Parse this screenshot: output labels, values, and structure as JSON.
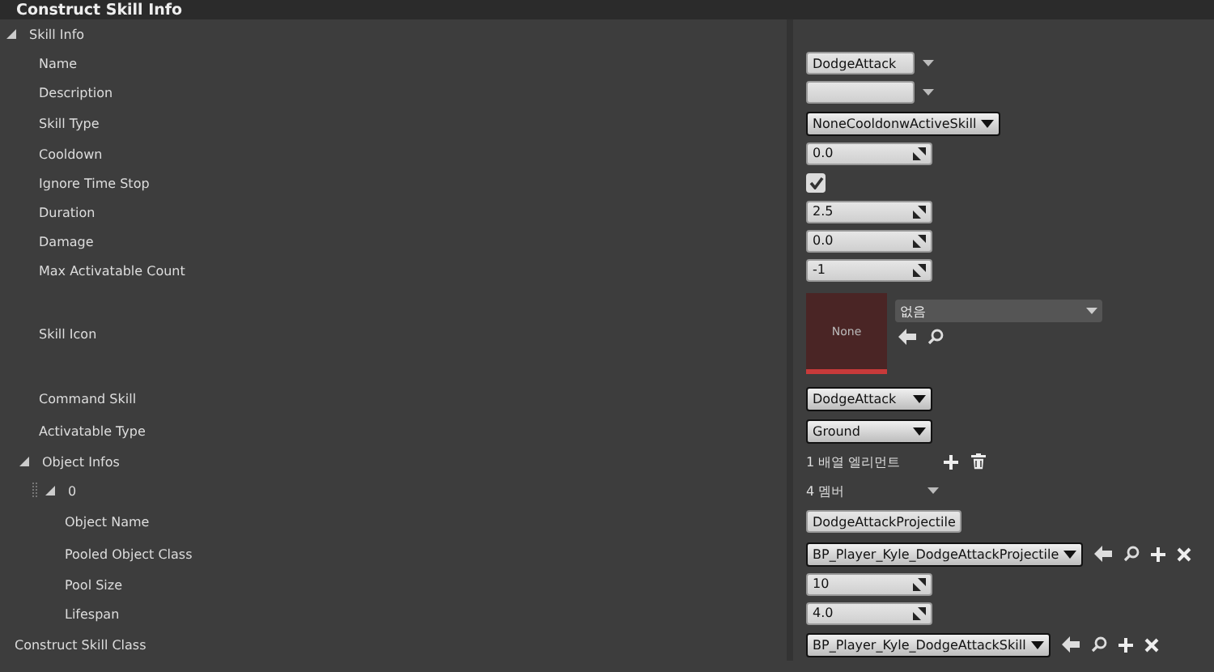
{
  "panel": {
    "title": "Construct Skill Info"
  },
  "properties": [
    {
      "label": "Skill Info",
      "kind": "group",
      "expanded": true,
      "children": [
        {
          "label": "Name",
          "kind": "text_combo",
          "value": "DodgeAttack"
        },
        {
          "label": "Description",
          "kind": "text_combo"
        },
        {
          "label": "Skill Type",
          "kind": "enum",
          "value": "NoneCooldonwActiveSkill"
        },
        {
          "label": "Cooldown",
          "kind": "number",
          "value": "0.0"
        },
        {
          "label": "Ignore Time Stop",
          "kind": "checkbox",
          "checked": true
        },
        {
          "label": "Duration",
          "kind": "number",
          "value": "2.5"
        },
        {
          "label": "Damage",
          "kind": "number",
          "value": "0.0"
        },
        {
          "label": "Max Activatable Count",
          "kind": "number",
          "value": "-1"
        },
        {
          "label": "Skill Icon",
          "kind": "asset",
          "thumbnail": "None",
          "value": "없음"
        },
        {
          "label": "Command Skill",
          "kind": "enum",
          "value": "DodgeAttack"
        },
        {
          "label": "Activatable Type",
          "kind": "enum",
          "value": "Ground"
        },
        {
          "label": "Object Infos",
          "kind": "array",
          "expanded": true,
          "value": "1 배열 엘리먼트",
          "children": [
            {
              "label": "0",
              "kind": "struct",
              "expanded": true,
              "value": "4 멤버",
              "children": [
                {
                  "label": "Object Name",
                  "kind": "text",
                  "value": "DodgeAttackProjectile"
                },
                {
                  "label": "Pooled Object Class",
                  "kind": "class",
                  "value": "BP_Player_Kyle_DodgeAttackProjectile"
                },
                {
                  "label": "Pool Size",
                  "kind": "number",
                  "value": "10"
                },
                {
                  "label": "Lifespan",
                  "kind": "number",
                  "value": "4.0"
                }
              ]
            }
          ]
        }
      ]
    },
    {
      "label": "Construct Skill Class",
      "kind": "class",
      "value": "BP_Player_Kyle_DodgeAttackSkill"
    }
  ]
}
